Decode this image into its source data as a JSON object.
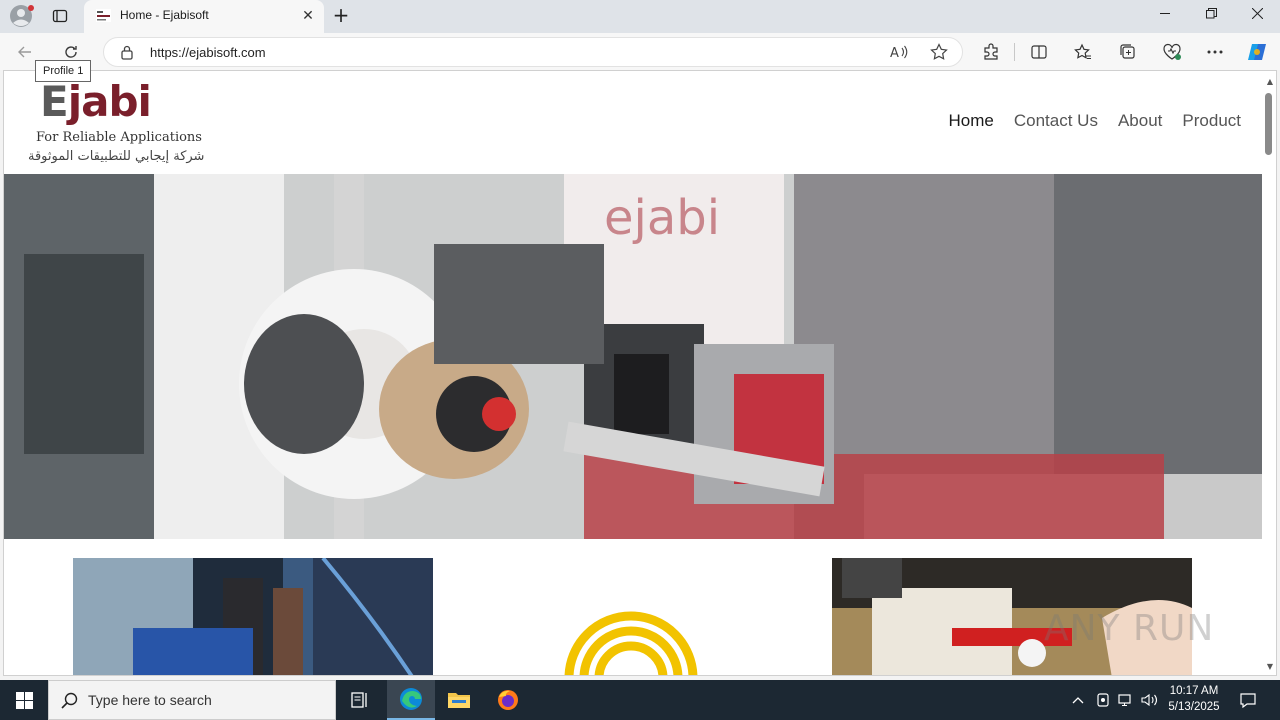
{
  "browser": {
    "tab_title": "Home - Ejabisoft",
    "url": "https://ejabisoft.com",
    "tooltip": "Profile 1",
    "accent": "#0078d4"
  },
  "site": {
    "logo": {
      "word": "Ejabi",
      "tagline": "For Reliable Applications",
      "arabic": "شركة إيجابي للتطبيقات الموثوقة",
      "brand_color": "#7a1f2b"
    },
    "nav": [
      {
        "label": "Home"
      },
      {
        "label": "Contact Us"
      },
      {
        "label": "About"
      },
      {
        "label": "Product"
      }
    ]
  },
  "watermark": "ANY RUN",
  "taskbar": {
    "search_placeholder": "Type here to search",
    "time": "10:17 AM",
    "date": "5/13/2025"
  }
}
